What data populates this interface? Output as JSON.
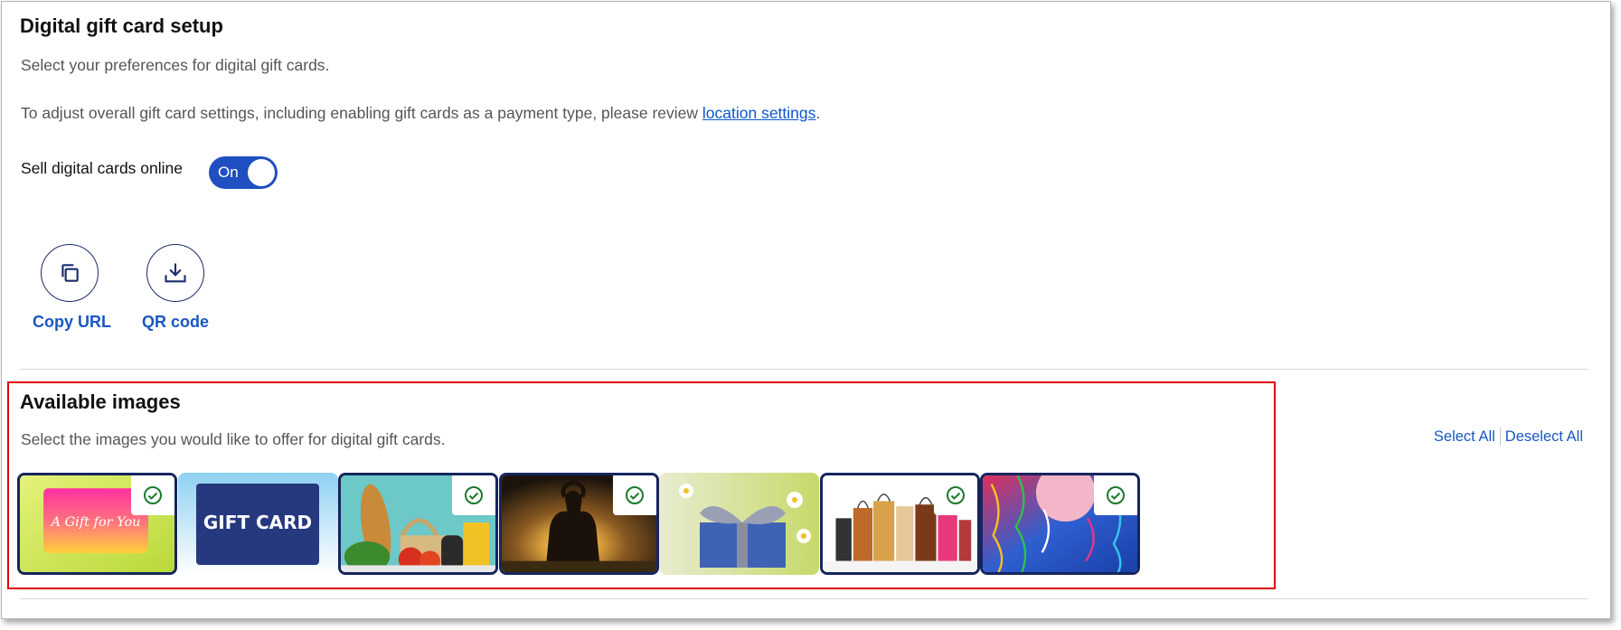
{
  "page": {
    "title": "Digital gift card setup",
    "subtitle": "Select your preferences for digital gift cards.",
    "adjust_text": "To adjust overall gift card settings, including enabling gift cards as a payment type, please review ",
    "adjust_link": "location settings",
    "adjust_end": "."
  },
  "sell_toggle": {
    "label": "Sell digital cards online",
    "state": "On"
  },
  "actions": {
    "copy_url": "Copy URL",
    "qr_code": "QR code"
  },
  "available_images": {
    "title": "Available images",
    "subtitle": "Select the images you would like to offer for digital gift cards.",
    "select_all": "Select All",
    "deselect_all": "Deselect All",
    "cards": [
      {
        "name": "a-gift-for-you",
        "text": "A Gift for You",
        "selected": true
      },
      {
        "name": "gift-card",
        "text": "GIFT CARD",
        "selected": false
      },
      {
        "name": "groceries",
        "selected": true
      },
      {
        "name": "sunset-silhouette",
        "selected": true
      },
      {
        "name": "wrapped-present",
        "selected": false
      },
      {
        "name": "shopping-bags",
        "selected": true
      },
      {
        "name": "party-balloons",
        "selected": true
      }
    ]
  },
  "colors": {
    "primary": "#1f4fc0",
    "link": "#0b57c9",
    "selected_border": "#16255e",
    "check": "#1a7a2e",
    "highlight": "#e00000"
  }
}
